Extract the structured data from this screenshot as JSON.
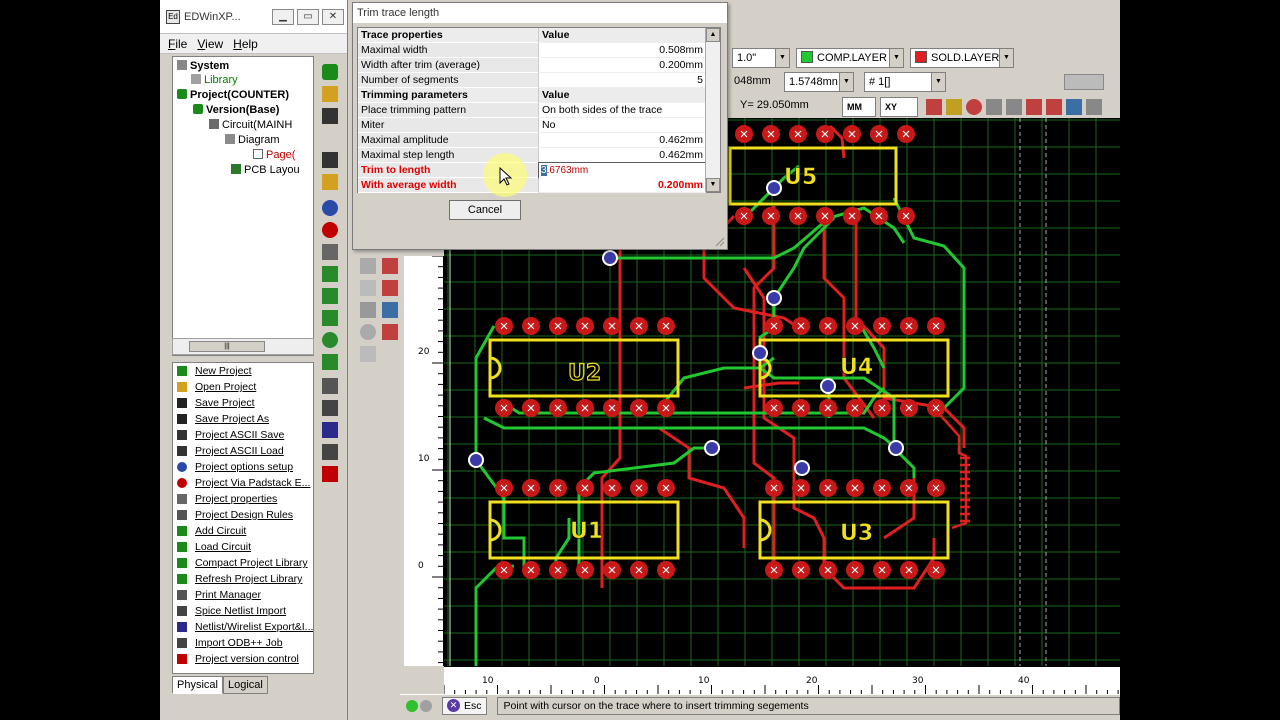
{
  "app": {
    "window_title": "EDWinXP...",
    "icon_label": "Ed"
  },
  "menu": [
    "File",
    "View",
    "Help"
  ],
  "tree": {
    "system": "System",
    "library": "Library",
    "project": "Project(COUNTER)",
    "version": "Version(Base)",
    "circuit": "Circuit(MAINH",
    "diagram": "Diagram",
    "page": "Page(",
    "pcb": "PCB Layou"
  },
  "hscroll_thumb": "|||",
  "commands": [
    "New Project",
    "Open Project",
    "Save Project",
    "Save Project As",
    "Project ASCII Save",
    "Project ASCII Load",
    "Project options setup",
    "Project Via Padstack E...",
    "Project properties",
    "Project Design Rules",
    "Add Circuit",
    "Load Circuit",
    "Compact Project Library",
    "Refresh Project Library",
    "Print Manager",
    "Spice Netlist Import",
    "Netlist/Wirelist Export&I...",
    "Import ODB++ Job",
    "Project version control"
  ],
  "tabs": [
    "Physical",
    "Logical"
  ],
  "toolbar": {
    "angle": "1.0\"",
    "comp_layer": "COMP.LAYER",
    "sold_layer": "SOLD.LAYER",
    "width_val": "048mm",
    "arc_val": "1.5748mn",
    "net_val": "# 1[]",
    "coord_y": "Y= 29.050mm",
    "units": "MM",
    "axes": "XY"
  },
  "dialog": {
    "title": "Trim trace length",
    "header_prop": "Trace properties",
    "header_val": "Value",
    "rows": [
      {
        "k": "Maximal width",
        "v": "0.508mm"
      },
      {
        "k": "Width after trim (average)",
        "v": "0.200mm"
      },
      {
        "k": "Number of segments",
        "v": "5"
      }
    ],
    "header2_prop": "Trimming parameters",
    "header2_val": "Value",
    "rows2": [
      {
        "k": "Place trimming pattern",
        "v": "On both sides of the trace"
      },
      {
        "k": "Miter",
        "v": "No"
      },
      {
        "k": "Maximal amplitude",
        "v": "0.462mm"
      },
      {
        "k": "Maximal step length",
        "v": "0.462mm"
      }
    ],
    "trim_label": "Trim to length",
    "trim_value_sel": "3",
    "trim_value_rest": ".6763mm",
    "avg_label": "With average width",
    "avg_value": "0.200mm",
    "cancel": "Cancel"
  },
  "ruler": {
    "v_labels": [
      "20",
      "10",
      "0"
    ],
    "h_labels": [
      "10",
      "0",
      "10",
      "20",
      "30",
      "40"
    ]
  },
  "components": [
    "U5",
    "U2",
    "U4",
    "U1",
    "U3"
  ],
  "status": {
    "esc": "Esc",
    "message": "Point with cursor on the trace where to insert trimming segements"
  },
  "colors": {
    "trace_green": "#22c832",
    "trace_red": "#e02020",
    "outline_yellow": "#f0e020",
    "grid": "#1a6a1a",
    "via_blue": "#3a3aa8"
  }
}
